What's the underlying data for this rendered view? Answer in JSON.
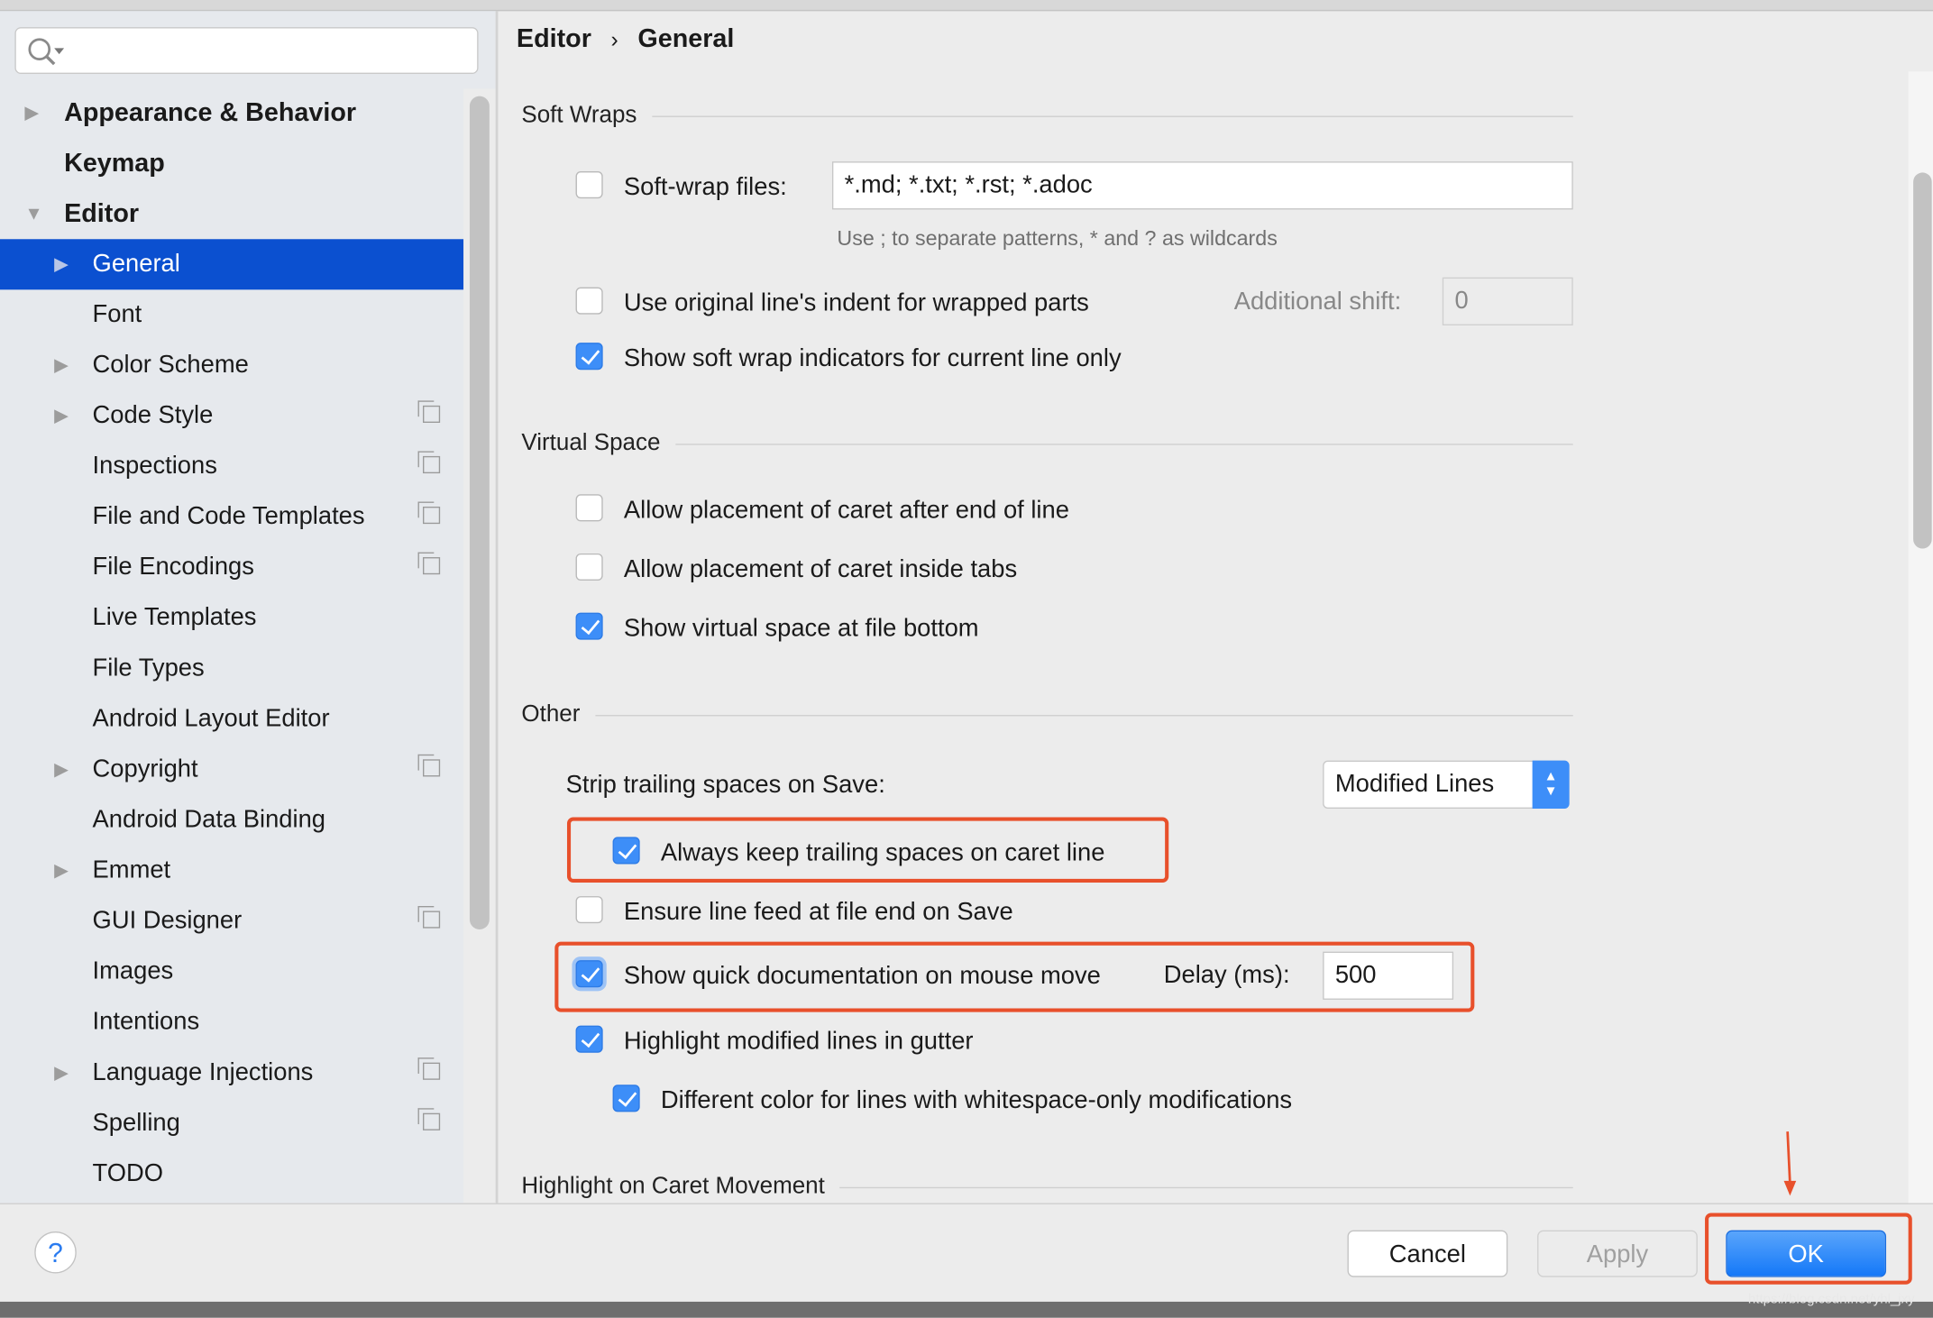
{
  "search": {
    "placeholder": ""
  },
  "sidebar": {
    "items": [
      {
        "label": "Appearance & Behavior",
        "level": 0,
        "expander": "collapsed",
        "bold": true
      },
      {
        "label": "Keymap",
        "level": 0,
        "expander": "none",
        "bold": true
      },
      {
        "label": "Editor",
        "level": 0,
        "expander": "expanded",
        "bold": true
      },
      {
        "label": "General",
        "level": 1,
        "expander": "collapsed",
        "selected": true
      },
      {
        "label": "Font",
        "level": 1,
        "expander": "none"
      },
      {
        "label": "Color Scheme",
        "level": 1,
        "expander": "collapsed"
      },
      {
        "label": "Code Style",
        "level": 1,
        "expander": "collapsed",
        "project_icon": true
      },
      {
        "label": "Inspections",
        "level": 1,
        "expander": "none",
        "project_icon": true
      },
      {
        "label": "File and Code Templates",
        "level": 1,
        "expander": "none",
        "project_icon": true
      },
      {
        "label": "File Encodings",
        "level": 1,
        "expander": "none",
        "project_icon": true
      },
      {
        "label": "Live Templates",
        "level": 1,
        "expander": "none"
      },
      {
        "label": "File Types",
        "level": 1,
        "expander": "none"
      },
      {
        "label": "Android Layout Editor",
        "level": 1,
        "expander": "none"
      },
      {
        "label": "Copyright",
        "level": 1,
        "expander": "collapsed",
        "project_icon": true
      },
      {
        "label": "Android Data Binding",
        "level": 1,
        "expander": "none"
      },
      {
        "label": "Emmet",
        "level": 1,
        "expander": "collapsed"
      },
      {
        "label": "GUI Designer",
        "level": 1,
        "expander": "none",
        "project_icon": true
      },
      {
        "label": "Images",
        "level": 1,
        "expander": "none"
      },
      {
        "label": "Intentions",
        "level": 1,
        "expander": "none"
      },
      {
        "label": "Language Injections",
        "level": 1,
        "expander": "collapsed",
        "project_icon": true
      },
      {
        "label": "Spelling",
        "level": 1,
        "expander": "none",
        "project_icon": true
      },
      {
        "label": "TODO",
        "level": 1,
        "expander": "none"
      }
    ]
  },
  "breadcrumb": {
    "parent": "Editor",
    "separator": "›",
    "current": "General"
  },
  "soft_wraps": {
    "title": "Soft Wraps",
    "soft_wrap_files": {
      "label": "Soft-wrap files:",
      "checked": false,
      "value": "*.md; *.txt; *.rst; *.adoc"
    },
    "hint": "Use ; to separate patterns, * and ? as wildcards",
    "original_indent": {
      "label": "Use original line's indent for wrapped parts",
      "checked": false
    },
    "additional_shift": {
      "label": "Additional shift:",
      "value": "0"
    },
    "indicators": {
      "label": "Show soft wrap indicators for current line only",
      "checked": true
    }
  },
  "virtual_space": {
    "title": "Virtual Space",
    "after_eol": {
      "label": "Allow placement of caret after end of line",
      "checked": false
    },
    "inside_tabs": {
      "label": "Allow placement of caret inside tabs",
      "checked": false
    },
    "file_bottom": {
      "label": "Show virtual space at file bottom",
      "checked": true
    }
  },
  "other": {
    "title": "Other",
    "strip_label": "Strip trailing spaces on Save:",
    "strip_value": "Modified Lines",
    "keep_trailing": {
      "label": "Always keep trailing spaces on caret line",
      "checked": true
    },
    "line_feed": {
      "label": "Ensure line feed at file end on Save",
      "checked": false
    },
    "quick_doc": {
      "label": "Show quick documentation on mouse move",
      "checked": true,
      "delay_label": "Delay (ms):",
      "delay_value": "500"
    },
    "highlight_modified": {
      "label": "Highlight modified lines in gutter",
      "checked": true
    },
    "whitespace_color": {
      "label": "Different color for lines with whitespace-only modifications",
      "checked": true
    }
  },
  "caret_movement": {
    "title": "Highlight on Caret Movement"
  },
  "footer": {
    "help": "?",
    "cancel": "Cancel",
    "apply": "Apply",
    "ok": "OK"
  },
  "watermark": "https://blog.csdn.net/yhl_jxy",
  "colors": {
    "selection": "#0b50d0",
    "accent": "#3d8ef8",
    "annotation": "#e8502b"
  }
}
